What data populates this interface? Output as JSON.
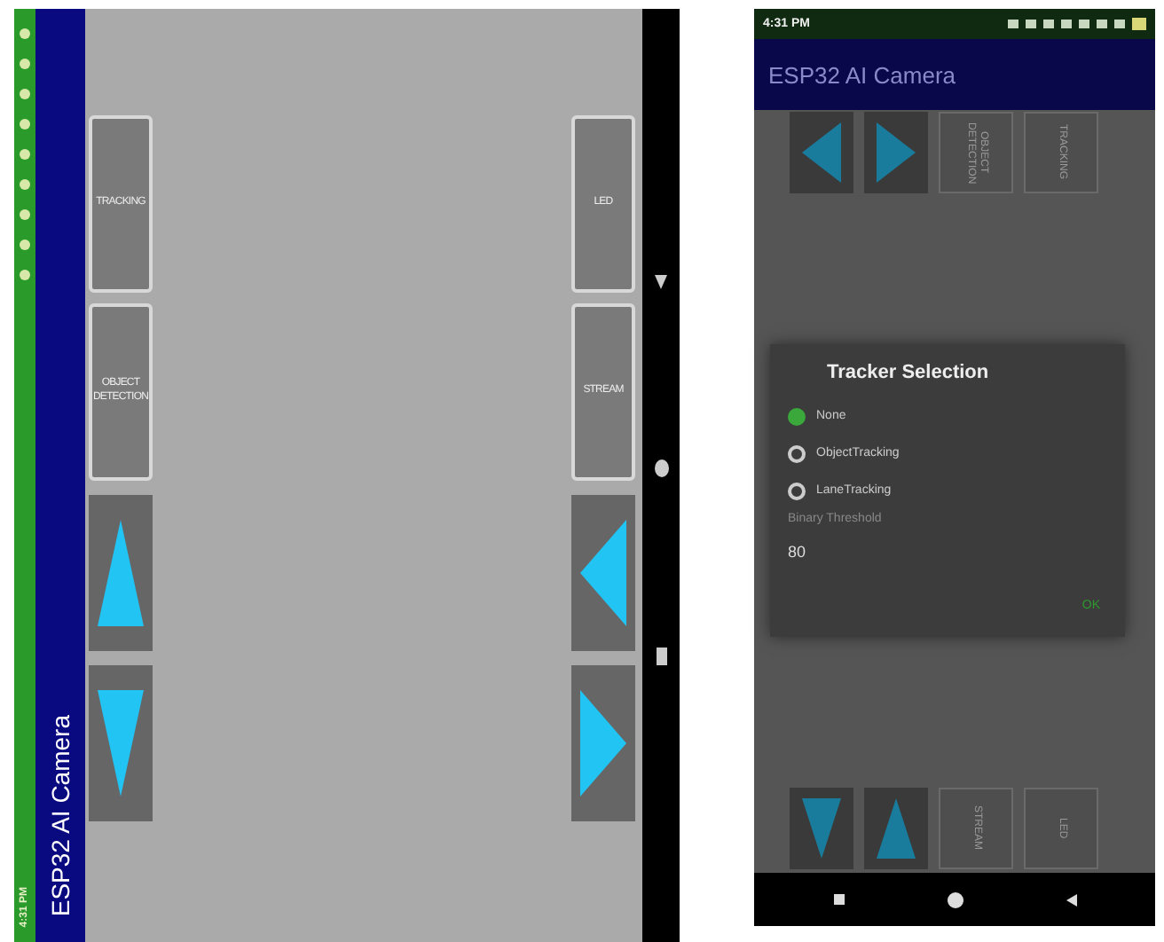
{
  "landscape_phone": {
    "status_bar": {
      "time": "4:31 PM"
    },
    "title": "ESP32 AI Camera",
    "left_buttons": [
      {
        "kind": "text",
        "label": "TRACKING"
      },
      {
        "kind": "text",
        "label": "OBJECT DETECTION"
      },
      {
        "kind": "up"
      },
      {
        "kind": "down"
      }
    ],
    "right_buttons": [
      {
        "kind": "text",
        "label": "LED"
      },
      {
        "kind": "text",
        "label": "STREAM"
      },
      {
        "kind": "left"
      },
      {
        "kind": "right"
      }
    ]
  },
  "portrait_phone": {
    "status_bar": {
      "time": "4:31 PM"
    },
    "title": "ESP32 AI Camera",
    "top_buttons": [
      {
        "kind": "left"
      },
      {
        "kind": "right"
      },
      {
        "kind": "text",
        "label": "OBJECT DETECTION"
      },
      {
        "kind": "text",
        "label": "TRACKING"
      }
    ],
    "dialog": {
      "title": "Tracker Selection",
      "options": [
        {
          "label": "None",
          "selected": true
        },
        {
          "label": "ObjectTracking",
          "selected": false
        },
        {
          "label": "LaneTracking",
          "selected": false
        }
      ],
      "field_label": "Binary Threshold",
      "value": "80",
      "button": "OK"
    },
    "bottom_buttons": [
      {
        "kind": "down"
      },
      {
        "kind": "up"
      },
      {
        "kind": "text",
        "label": "STREAM"
      },
      {
        "kind": "text",
        "label": "LED"
      }
    ]
  }
}
